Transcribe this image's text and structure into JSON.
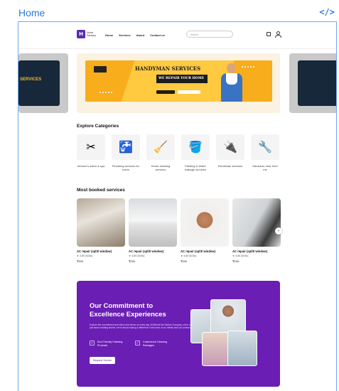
{
  "frame": {
    "title": "Home",
    "code_icon": "</>"
  },
  "header": {
    "logo_mark": "H",
    "logo_text_1": "Home",
    "logo_text_2": "Sanitary",
    "nav": [
      "Home",
      "Services",
      "About",
      "Contact us"
    ],
    "search_placeholder": "Search"
  },
  "carousel": {
    "side_left_text": "SERVICES",
    "banner_title": "HANDYMAN SERVICES",
    "banner_subtitle": "WE REPAIR YOUR HOME"
  },
  "categories": {
    "title": "Explore Categories",
    "items": [
      {
        "label": "Women's salon & spa",
        "icon": "✂"
      },
      {
        "label": "Plumbing services for home",
        "icon": "🚰"
      },
      {
        "label": "Home cleaning services",
        "icon": "🧹"
      },
      {
        "label": "Painting & Water leakage services",
        "icon": "🪣"
      },
      {
        "label": "Electrician services",
        "icon": "🔌"
      },
      {
        "label": "Mechanic near from me",
        "icon": "🔧"
      }
    ]
  },
  "services": {
    "title": "Most booked services",
    "items": [
      {
        "name": "AC repair (split/ window)",
        "rating": "★ 4.80 (524k)",
        "price": "₹299"
      },
      {
        "name": "AC repair (split/ window)",
        "rating": "★ 4.80 (524k)",
        "price": "₹299"
      },
      {
        "name": "AC repair (split/ window)",
        "rating": "★ 4.80 (524k)",
        "price": "₹299"
      },
      {
        "name": "AC repair (split/ window)",
        "rating": "★ 4.80 (524k)",
        "price": "₹299"
      }
    ],
    "next_icon": "›"
  },
  "commitment": {
    "title": "Our Commitment to Excellence Experiences",
    "description": "Explore the commitment and vision that drives us every day. At Behind the Stories Company, we're not just about creating stories; we're about making a difference in the lives of our clients and our community.",
    "features": [
      {
        "label": "Eco-Friendly Cleaning Products",
        "icon": "✓"
      },
      {
        "label": "Customized Cleaning Packages",
        "icon": "✓"
      }
    ],
    "button": "Request Service"
  }
}
